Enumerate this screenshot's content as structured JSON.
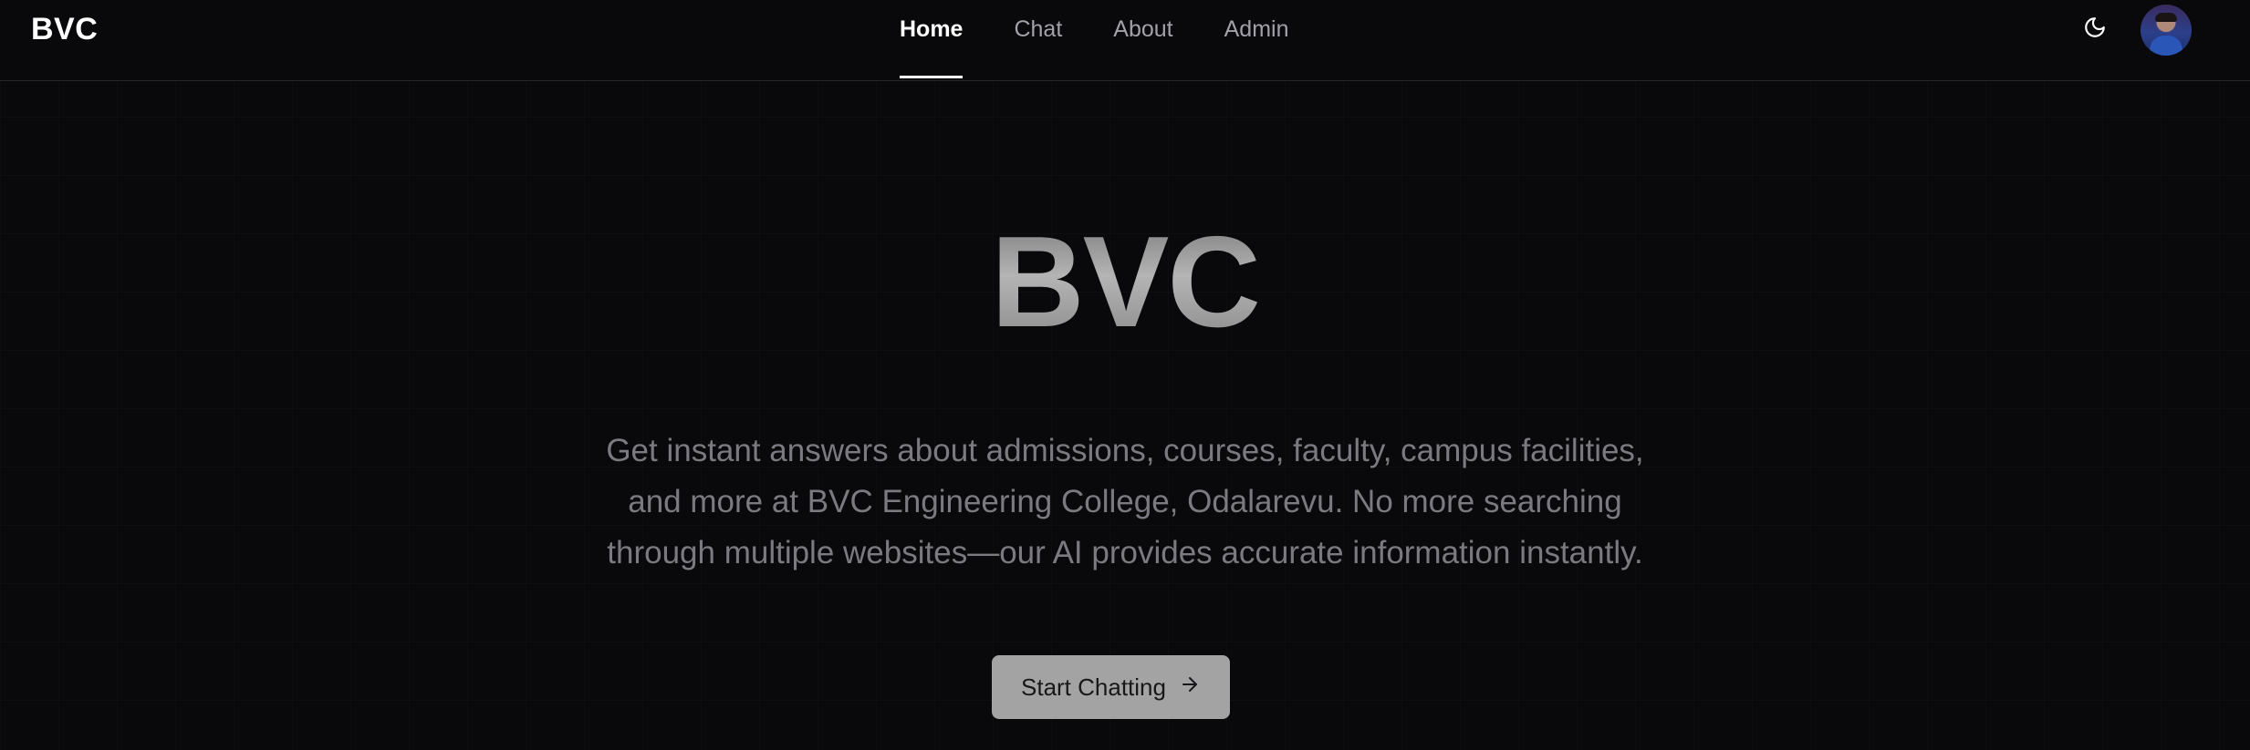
{
  "header": {
    "brand": "BVC",
    "nav": [
      {
        "label": "Home",
        "active": true
      },
      {
        "label": "Chat",
        "active": false
      },
      {
        "label": "About",
        "active": false
      },
      {
        "label": "Admin",
        "active": false
      }
    ],
    "theme_toggle_icon": "moon-icon",
    "avatar_icon": "user-avatar"
  },
  "hero": {
    "title": "BVC",
    "description": "Get instant answers about admissions, courses, faculty, campus facilities, and more at BVC Engineering College, Odalarevu. No more searching through multiple websites—our AI provides accurate information instantly.",
    "cta_label": "Start Chatting",
    "cta_icon": "arrow-right-icon"
  },
  "colors": {
    "background": "#09090b",
    "nav_inactive": "#a1a1aa",
    "nav_active": "#ffffff",
    "description_text": "#7a7a80",
    "cta_background": "#a3a3a3",
    "cta_text": "#18181b"
  }
}
